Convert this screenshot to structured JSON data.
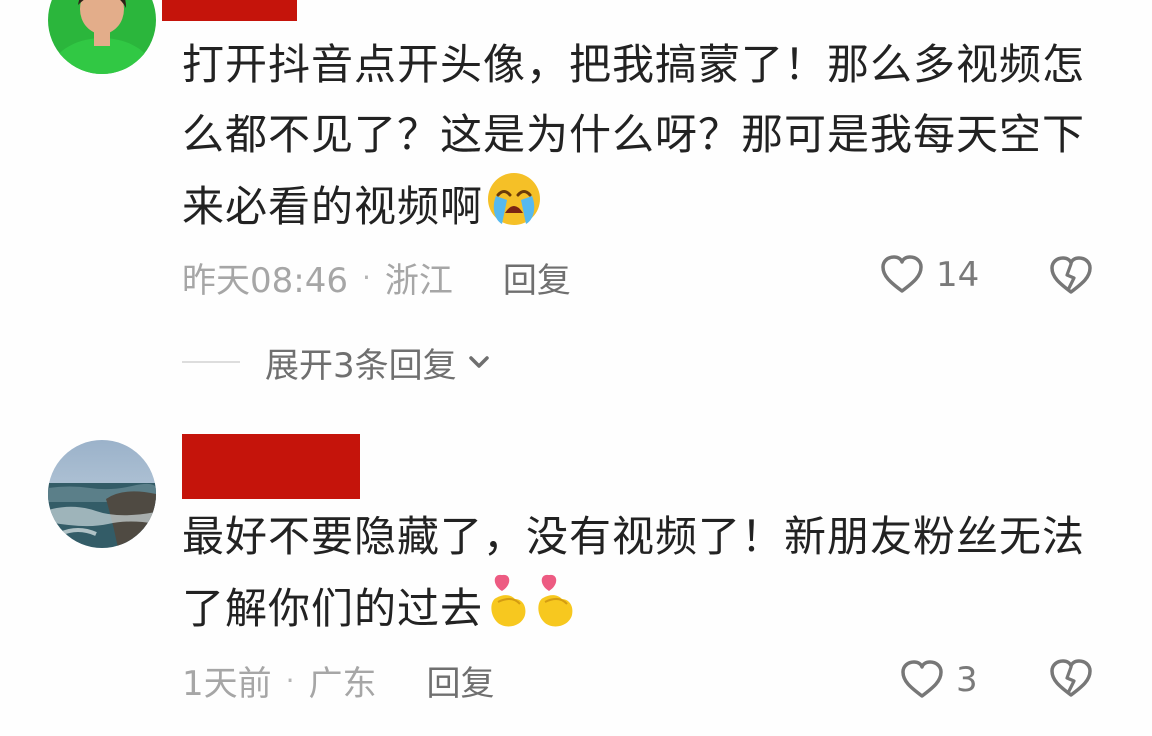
{
  "comments": [
    {
      "text": "打开抖音点开头像，把我搞蒙了！那么多视频怎么都不见了？这是为什么呀？那可是我每天空下来必看的视频啊",
      "emoji": "loudly-crying-face-emoji",
      "time": "昨天08:46",
      "location": "浙江",
      "reply_label": "回复",
      "like_count": "14",
      "expand_label": "展开3条回复"
    },
    {
      "text": "最好不要隐藏了，没有视频了！新朋友粉丝无法了解你们的过去",
      "emoji": "finger-heart-emoji",
      "time": "1天前",
      "location": "广东",
      "reply_label": "回复",
      "like_count": "3"
    }
  ],
  "icons": {
    "like": "heart-outline-icon",
    "dislike": "broken-heart-icon",
    "expand": "chevron-down-icon"
  },
  "colors": {
    "name_redaction": "#c5140b",
    "muted_text": "#a6a6a6",
    "action_text": "#6f6f6f",
    "primary_text": "#222222"
  }
}
